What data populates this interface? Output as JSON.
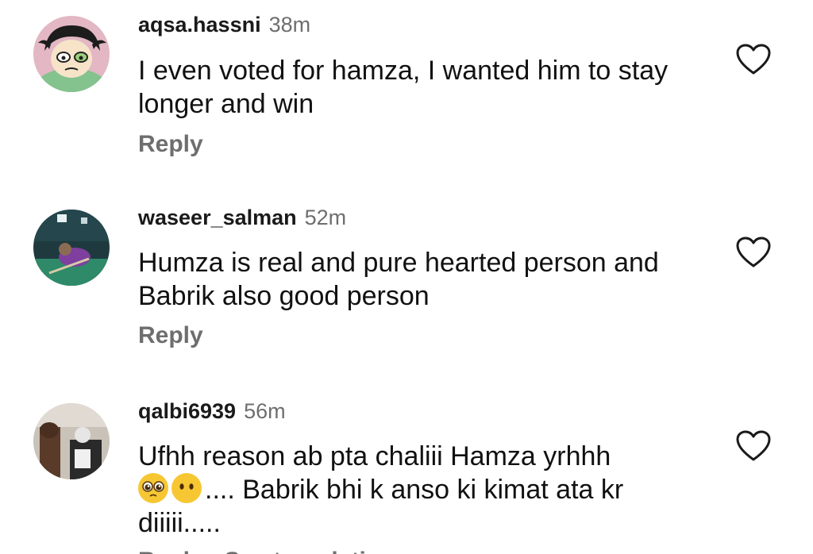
{
  "comments": [
    {
      "username": "aqsa.hassni",
      "time": "38m",
      "text": "I even voted for hamza, I wanted him to stay longer and win",
      "reply_label": "Reply"
    },
    {
      "username": "waseer_salman",
      "time": "52m",
      "text": "Humza is real and pure hearted person and Babrik also good person",
      "reply_label": "Reply"
    },
    {
      "username": "qalbi6939",
      "time": "56m",
      "text_line1": "Ufhh reason ab pta chaliii Hamza yrhhh",
      "text_line2_after_emoji": ".... Babrik bhi k anso ki kimat ata kr",
      "text_line3": "diiiii.....",
      "emojis": [
        "pleading-face",
        "face-without-mouth"
      ],
      "reply_label": "Reply"
    }
  ],
  "partial_next_line": "Reply · See translation",
  "icons": {
    "like": "heart-outline-icon"
  },
  "colors": {
    "username": "#1a1a1a",
    "meta": "#6e6e6e",
    "text": "#111111",
    "background": "#ffffff"
  }
}
